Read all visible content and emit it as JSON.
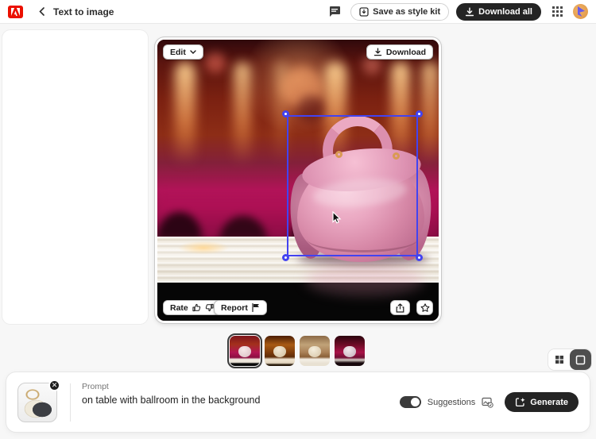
{
  "colors": {
    "accent_blue": "#4343f0",
    "adobe_red": "#eb1000",
    "dark_button": "#242424",
    "page_bg": "#f7f7f7"
  },
  "header": {
    "title": "Text to image",
    "logo_icon": "adobe-logo",
    "back_icon": "chevron-left-icon",
    "feedback_icon": "feedback-icon",
    "apps_icon": "apps-grid-icon",
    "avatar_icon": "user-avatar",
    "save_style_kit_label": "Save as style kit",
    "download_all_label": "Download all"
  },
  "canvas": {
    "edit_label": "Edit",
    "edit_icon": "chevron-down-icon",
    "download_label": "Download",
    "download_icon": "download-icon",
    "rate_label": "Rate",
    "rate_icons": [
      "thumbs-up-icon",
      "thumbs-down-icon"
    ],
    "report_label": "Report",
    "report_icon": "flag-icon",
    "share_icon": "share-icon",
    "favorite_icon": "star-icon",
    "selection_handles": 4,
    "cursor_icon": "pointer-cursor"
  },
  "thumbnails": {
    "count": 4,
    "selected_index": 0
  },
  "view_toggle": {
    "grid_icon": "grid-view-icon",
    "single_icon": "single-view-icon",
    "selected": "single"
  },
  "prompt_bar": {
    "label": "Prompt",
    "value": "on table with ballroom in the background",
    "reference_remove_icon": "close-icon",
    "remove_glyph": "✕",
    "suggestions_label": "Suggestions",
    "suggestions_on": true,
    "suggestions_icon": "image-check-icon",
    "generate_label": "Generate",
    "generate_icon": "generate-icon"
  }
}
